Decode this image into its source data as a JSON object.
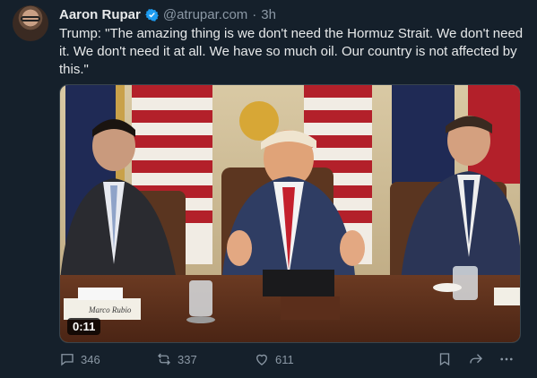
{
  "author": {
    "name": "Aaron Rupar",
    "handle": "@atrupar.com",
    "separator": "·",
    "time": "3h"
  },
  "post_text": "Trump: \"The amazing thing is we don't need the Hormuz Strait. We don't need it. We don't need it at all. We have so much oil. Our country is not affected by this.\"",
  "media": {
    "duration": "0:11",
    "nameplate": "Marco Rubio"
  },
  "stats": {
    "replies": "346",
    "reposts": "337",
    "likes": "611"
  },
  "colors": {
    "background": "#15202b",
    "text": "#e7e9ea",
    "muted": "#8b98a5",
    "verified": "#1d9bf0"
  },
  "icons": [
    "avatar",
    "verified-icon",
    "reply-icon",
    "repost-icon",
    "like-icon",
    "bookmark-icon",
    "share-icon",
    "more-icon"
  ]
}
